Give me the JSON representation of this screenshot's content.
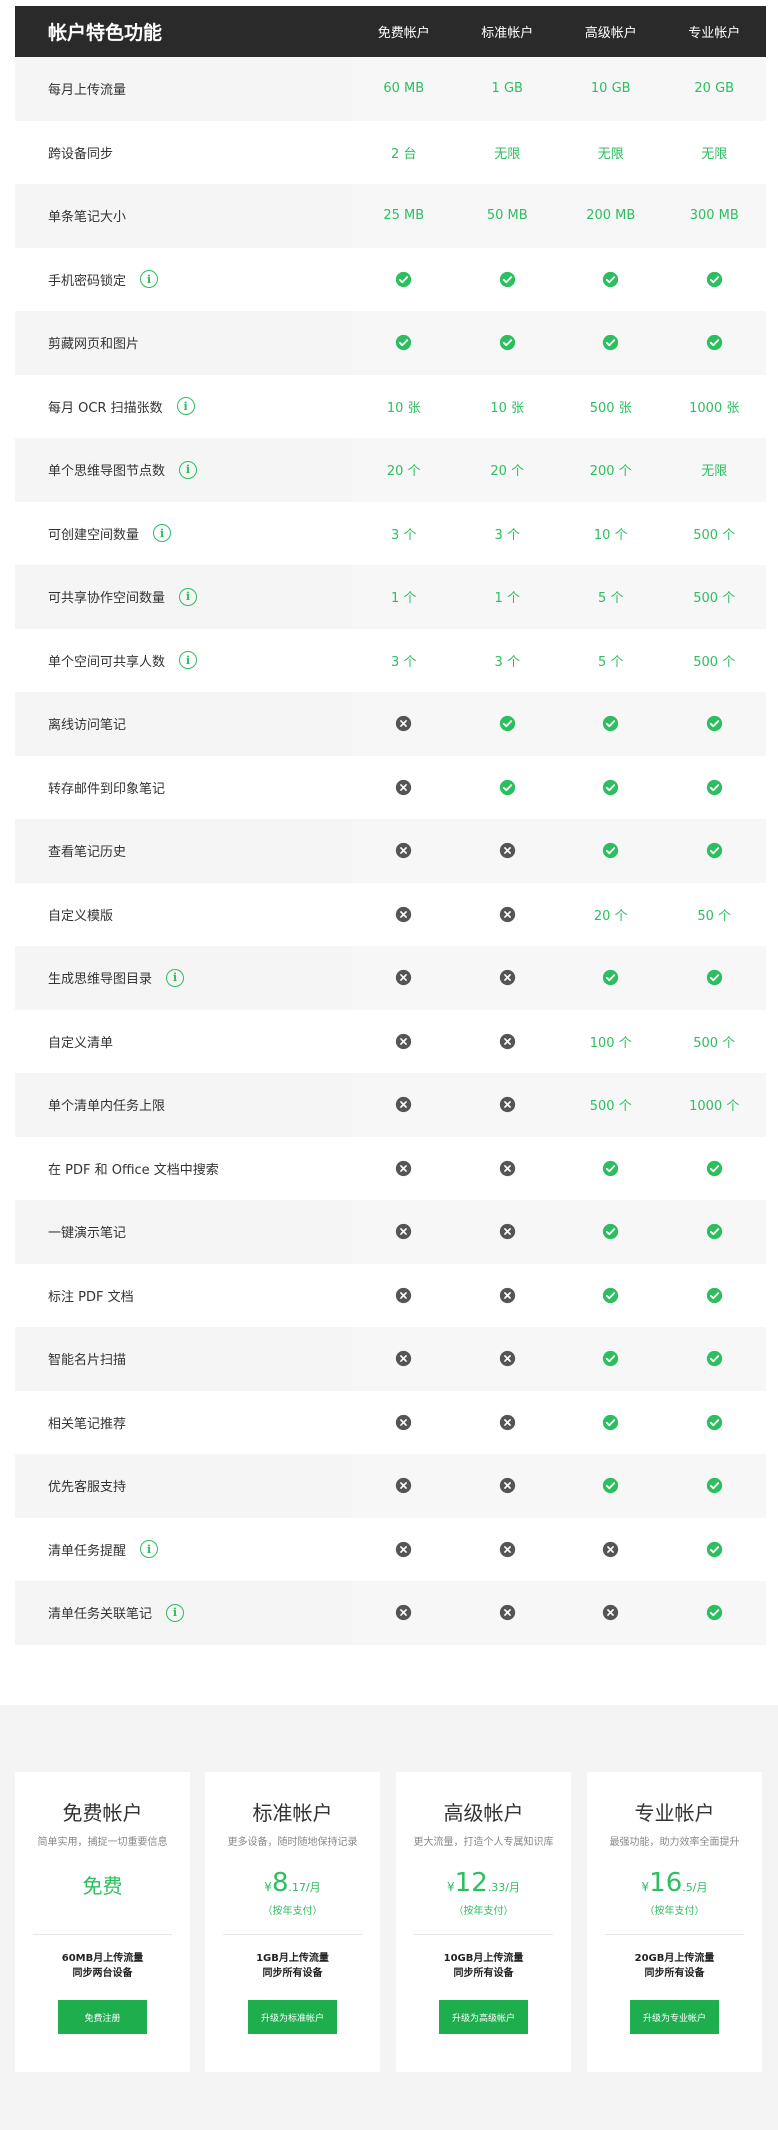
{
  "table": {
    "header": {
      "title": "帐户特色功能",
      "columns": [
        "免费帐户",
        "标准帐户",
        "高级帐户",
        "专业帐户"
      ]
    },
    "rows": [
      {
        "label": "每月上传流量",
        "info": false,
        "values": [
          "60 MB",
          "1 GB",
          "10 GB",
          "20 GB"
        ]
      },
      {
        "label": "跨设备同步",
        "info": false,
        "values": [
          "2 台",
          "无限",
          "无限",
          "无限"
        ]
      },
      {
        "label": "单条笔记大小",
        "info": false,
        "values": [
          "25 MB",
          "50 MB",
          "200 MB",
          "300 MB"
        ]
      },
      {
        "label": "手机密码锁定",
        "info": true,
        "values": [
          "check",
          "check",
          "check",
          "check"
        ]
      },
      {
        "label": "剪藏网页和图片",
        "info": false,
        "values": [
          "check",
          "check",
          "check",
          "check"
        ]
      },
      {
        "label": "每月 OCR 扫描张数",
        "info": true,
        "values": [
          "10 张",
          "10 张",
          "500 张",
          "1000 张"
        ]
      },
      {
        "label": "单个思维导图节点数",
        "info": true,
        "values": [
          "20 个",
          "20 个",
          "200 个",
          "无限"
        ]
      },
      {
        "label": "可创建空间数量",
        "info": true,
        "values": [
          "3 个",
          "3 个",
          "10 个",
          "500 个"
        ]
      },
      {
        "label": "可共享协作空间数量",
        "info": true,
        "values": [
          "1 个",
          "1 个",
          "5 个",
          "500 个"
        ]
      },
      {
        "label": "单个空间可共享人数",
        "info": true,
        "values": [
          "3 个",
          "3 个",
          "5 个",
          "500 个"
        ]
      },
      {
        "label": "离线访问笔记",
        "info": false,
        "values": [
          "cross",
          "check",
          "check",
          "check"
        ]
      },
      {
        "label": "转存邮件到印象笔记",
        "info": false,
        "values": [
          "cross",
          "check",
          "check",
          "check"
        ]
      },
      {
        "label": "查看笔记历史",
        "info": false,
        "values": [
          "cross",
          "cross",
          "check",
          "check"
        ]
      },
      {
        "label": "自定义模版",
        "info": false,
        "values": [
          "cross",
          "cross",
          "20 个",
          "50 个"
        ]
      },
      {
        "label": "生成思维导图目录",
        "info": true,
        "values": [
          "cross",
          "cross",
          "check",
          "check"
        ]
      },
      {
        "label": "自定义清单",
        "info": false,
        "values": [
          "cross",
          "cross",
          "100 个",
          "500 个"
        ]
      },
      {
        "label": "单个清单内任务上限",
        "info": false,
        "values": [
          "cross",
          "cross",
          "500 个",
          "1000 个"
        ]
      },
      {
        "label": "在 PDF 和 Office 文档中搜索",
        "info": false,
        "values": [
          "cross",
          "cross",
          "check",
          "check"
        ]
      },
      {
        "label": "一键演示笔记",
        "info": false,
        "values": [
          "cross",
          "cross",
          "check",
          "check"
        ]
      },
      {
        "label": "标注 PDF 文档",
        "info": false,
        "values": [
          "cross",
          "cross",
          "check",
          "check"
        ]
      },
      {
        "label": "智能名片扫描",
        "info": false,
        "values": [
          "cross",
          "cross",
          "check",
          "check"
        ]
      },
      {
        "label": "相关笔记推荐",
        "info": false,
        "values": [
          "cross",
          "cross",
          "check",
          "check"
        ]
      },
      {
        "label": "优先客服支持",
        "info": false,
        "values": [
          "cross",
          "cross",
          "check",
          "check"
        ]
      },
      {
        "label": "清单任务提醒",
        "info": true,
        "values": [
          "cross",
          "cross",
          "cross",
          "check"
        ]
      },
      {
        "label": "清单任务关联笔记",
        "info": true,
        "values": [
          "cross",
          "cross",
          "cross",
          "check"
        ]
      }
    ]
  },
  "plans": [
    {
      "name": "免费帐户",
      "desc": "简单实用，捕捉一切重要信息",
      "price_free": "免费",
      "price_currency": "",
      "price_int": "",
      "price_dec": "",
      "billing": "",
      "feature1": "60MB月上传流量",
      "feature2": "同步两台设备",
      "button": "免费注册"
    },
    {
      "name": "标准帐户",
      "desc": "更多设备，随时随地保持记录",
      "price_free": "",
      "price_currency": "¥",
      "price_int": "8",
      "price_dec": ".17/月",
      "billing": "（按年支付）",
      "feature1": "1GB月上传流量",
      "feature2": "同步所有设备",
      "button": "升级为标准帐户"
    },
    {
      "name": "高级帐户",
      "desc": "更大流量，打造个人专属知识库",
      "price_free": "",
      "price_currency": "¥",
      "price_int": "12",
      "price_dec": ".33/月",
      "billing": "（按年支付）",
      "feature1": "10GB月上传流量",
      "feature2": "同步所有设备",
      "button": "升级为高级帐户"
    },
    {
      "name": "专业帐户",
      "desc": "最强功能，助力效率全面提升",
      "price_free": "",
      "price_currency": "¥",
      "price_int": "16",
      "price_dec": ".5/月",
      "billing": "（按年支付）",
      "feature1": "20GB月上传流量",
      "feature2": "同步所有设备",
      "button": "升级为专业帐户"
    }
  ],
  "icons": {
    "info": "info-icon",
    "check": "check-circle-icon",
    "cross": "cross-circle-icon"
  },
  "colors": {
    "accent": "#2dbe60",
    "header_bg": "#2a2a2a",
    "cross": "#555555",
    "button": "#1fae4e"
  }
}
